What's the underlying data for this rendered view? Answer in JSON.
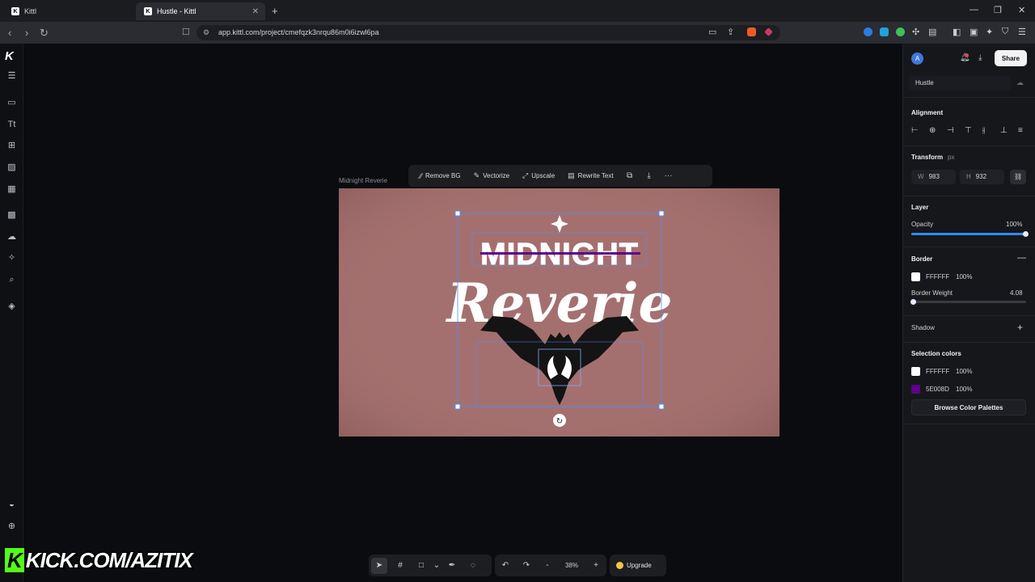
{
  "browser": {
    "tabs": [
      {
        "label": "Kittl",
        "favicon": "K"
      },
      {
        "label": "Hustle - Kittl",
        "favicon": "K"
      }
    ],
    "url": "app.kittl.com/project/cmefqzk3nrqu86m0i6izwl6pa"
  },
  "canvas": {
    "frame_label": "Midnight Reverie",
    "artboard_color": "#a4706f",
    "design": {
      "line1": "MIDNIGHT",
      "line2": "Reverie"
    }
  },
  "context_toolbar": {
    "remove_bg": "Remove BG",
    "vectorize": "Vectorize",
    "upscale": "Upscale",
    "rewrite_text": "Rewrite Text"
  },
  "bottom_toolbar": {
    "zoom": "38%",
    "upgrade": "Upgrade",
    "zoom_out": "-",
    "zoom_in": "+"
  },
  "right_panel": {
    "share": "Share",
    "avatar": "A",
    "project_name": "Hustle",
    "alignment": {
      "title": "Alignment"
    },
    "transform": {
      "title": "Transform",
      "unit": "px",
      "w_label": "W",
      "w_value": "983",
      "h_label": "H",
      "h_value": "932"
    },
    "layer": {
      "title": "Layer",
      "opacity_label": "Opacity",
      "opacity_value": "100%",
      "opacity_fraction": 1.0
    },
    "border": {
      "title": "Border",
      "color": "FFFFFF",
      "color_opacity": "100%",
      "weight_label": "Border Weight",
      "weight_value": "4.08",
      "weight_fraction": 0.02
    },
    "shadow": {
      "title": "Shadow"
    },
    "selection_colors": {
      "title": "Selection colors",
      "colors": [
        {
          "hex": "FFFFFF",
          "opacity": "100%",
          "swatch": "#ffffff"
        },
        {
          "hex": "5E008D",
          "opacity": "100%",
          "swatch": "#5e008d"
        }
      ],
      "browse_button": "Browse Color Palettes"
    }
  },
  "overlay": {
    "watermark_badge": "K",
    "watermark_text": "KICK.COM/AZITIX"
  }
}
